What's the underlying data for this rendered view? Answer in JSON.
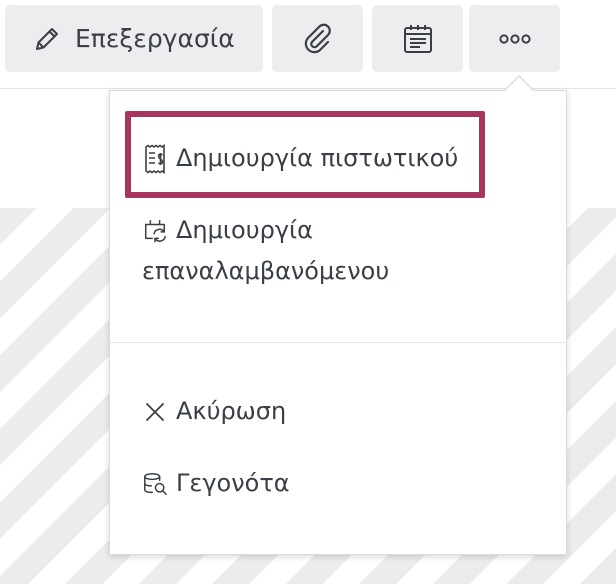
{
  "toolbar": {
    "edit_label": "Επεξεργασία",
    "icons": [
      "pencil-icon",
      "paperclip-icon",
      "calendar-icon",
      "more-icon"
    ]
  },
  "menu": {
    "items": [
      {
        "label": "Δημιουργία πιστωτικού",
        "icon": "receipt-icon",
        "highlighted": true
      },
      {
        "label": "Δημιουργία επαναλαμβανόμενου",
        "icon": "recurring-icon"
      },
      {
        "label": "Ακύρωση",
        "icon": "close-icon"
      },
      {
        "label": "Γεγονότα",
        "icon": "events-icon"
      }
    ]
  },
  "colors": {
    "highlight": "#a83560",
    "button_bg": "#ededef",
    "text": "#3a3f47",
    "stripe": "#ececee"
  }
}
